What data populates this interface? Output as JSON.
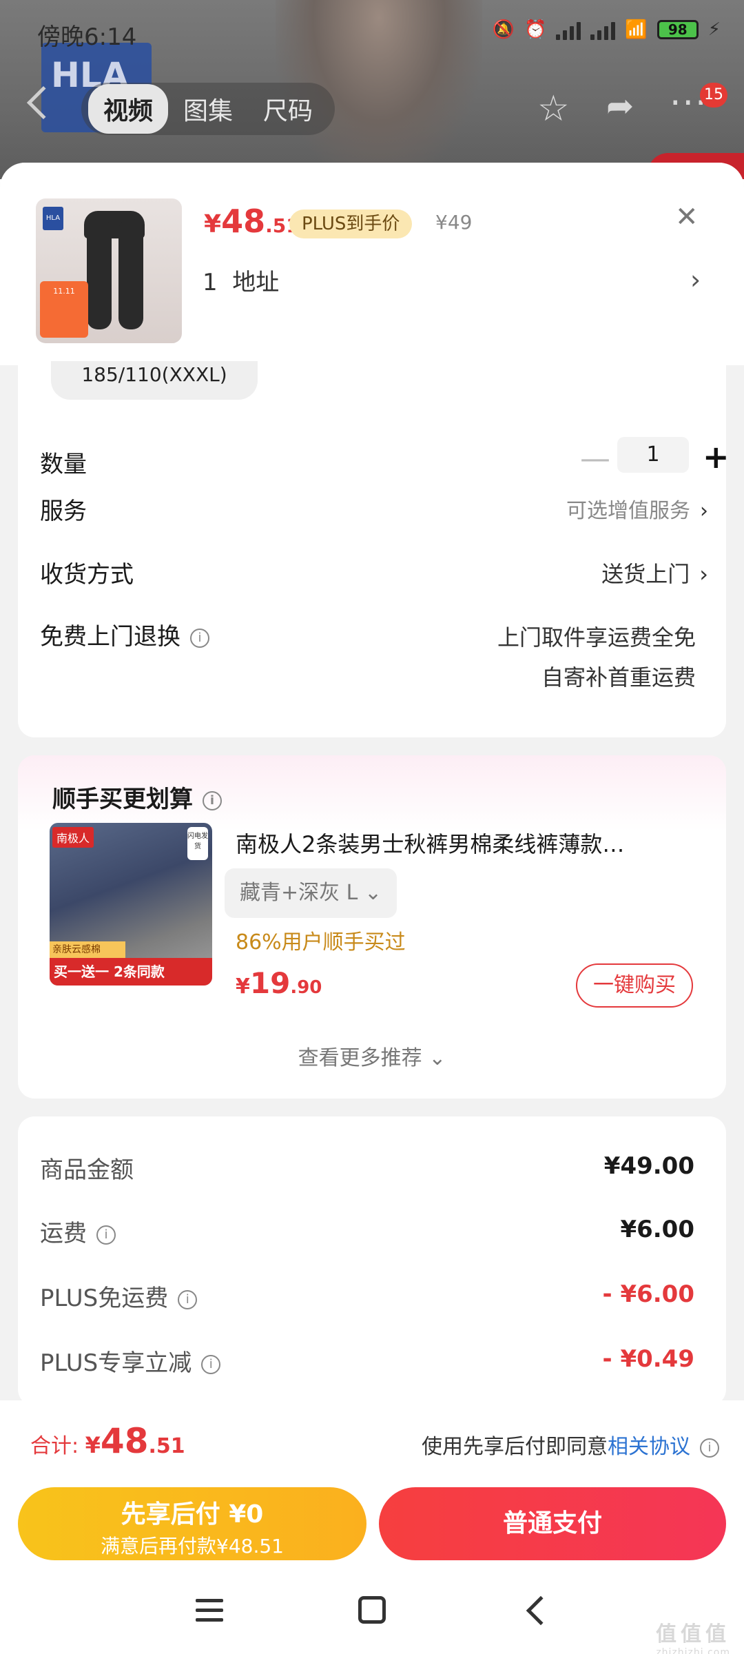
{
  "status_bar": {
    "time": "傍晚6:14",
    "icons": [
      "mute-icon",
      "alarm-icon",
      "signal-icon",
      "signal-icon",
      "wifi-icon",
      "battery-icon",
      "charging-icon"
    ],
    "battery": "98"
  },
  "nav": {
    "tabs": [
      {
        "label": "视频",
        "active": true
      },
      {
        "label": "图集",
        "active": false
      },
      {
        "label": "尺码",
        "active": false
      }
    ],
    "badge_count": "15"
  },
  "product": {
    "price_currency": "¥",
    "price_int": "48",
    "price_dec": ".51",
    "plus_tag": "PLUS到手价",
    "original_price": "¥49",
    "address_count": "1",
    "address_label": "地址"
  },
  "size_selected": "185/110(XXXL)",
  "options": {
    "quantity_label": "数量",
    "quantity_value": "1",
    "service_label": "服务",
    "service_value": "可选增值服务",
    "delivery_label": "收货方式",
    "delivery_value": "送货上门",
    "return_label": "免费上门退换",
    "return_line1": "上门取件享运费全免",
    "return_line2": "自寄补首重运费"
  },
  "recommend": {
    "title": "顺手买更划算",
    "item_name": "南极人2条装男士秋裤男棉柔线裤薄款…",
    "spec": "藏青+深灰   L",
    "percent_text": "86%用户顺手买过",
    "price_currency": "¥",
    "price_int": "19",
    "price_dec": ".90",
    "buy_label": "一键购买",
    "more_label": "查看更多推荐",
    "img_brand": "南极人",
    "img_flash": "闪电发货",
    "img_strip": "买一送一 2条同款",
    "img_strip2": "亲肤云感棉"
  },
  "summary": {
    "rows": [
      {
        "label": "商品金额",
        "value": "¥49.00",
        "info": false,
        "red": false
      },
      {
        "label": "运费",
        "value": "¥6.00",
        "info": true,
        "red": false
      },
      {
        "label": "PLUS免运费",
        "value": "- ¥6.00",
        "info": true,
        "red": true
      },
      {
        "label": "PLUS专享立减",
        "value": "- ¥0.49",
        "info": true,
        "red": true
      }
    ]
  },
  "bottom": {
    "total_label": "合计: ",
    "total_currency": "¥",
    "total_int": "48",
    "total_dec": ".51",
    "agree_prefix": "使用先享后付即同意",
    "agree_link": "相关协议",
    "later_line1": "先享后付 ¥0",
    "later_line2": "满意后再付款¥48.51",
    "pay_label": "普通支付"
  },
  "watermark": {
    "main": "值值值",
    "sub": "zhizhizhi.com"
  },
  "colors": {
    "accent_red": "#e4393c",
    "gold": "#fbb01e",
    "link_blue": "#2c73d2"
  }
}
